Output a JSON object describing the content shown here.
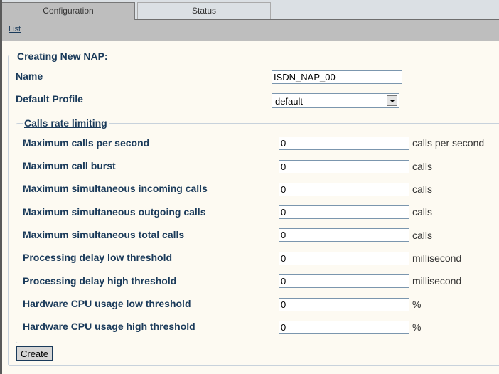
{
  "tabs": [
    {
      "label": "Configuration",
      "active": true
    },
    {
      "label": "Status",
      "active": false
    }
  ],
  "subnav": {
    "list_link": "List"
  },
  "form": {
    "legend": "Creating New NAP:",
    "name_label": "Name",
    "name_value": "ISDN_NAP_00",
    "profile_label": "Default Profile",
    "profile_value": "default",
    "rate_legend": "Calls rate limiting",
    "rows": [
      {
        "label": "Maximum calls per second",
        "value": "0",
        "unit": "calls per second"
      },
      {
        "label": "Maximum call burst",
        "value": "0",
        "unit": "calls"
      },
      {
        "label": "Maximum simultaneous incoming calls",
        "value": "0",
        "unit": "calls"
      },
      {
        "label": "Maximum simultaneous outgoing calls",
        "value": "0",
        "unit": "calls"
      },
      {
        "label": "Maximum simultaneous total calls",
        "value": "0",
        "unit": "calls"
      },
      {
        "label": "Processing delay low threshold",
        "value": "0",
        "unit": "millisecond"
      },
      {
        "label": "Processing delay high threshold",
        "value": "0",
        "unit": "millisecond"
      },
      {
        "label": "Hardware CPU usage low threshold",
        "value": "0",
        "unit": "%"
      },
      {
        "label": "Hardware CPU usage high threshold",
        "value": "0",
        "unit": "%"
      }
    ],
    "create_label": "Create"
  }
}
